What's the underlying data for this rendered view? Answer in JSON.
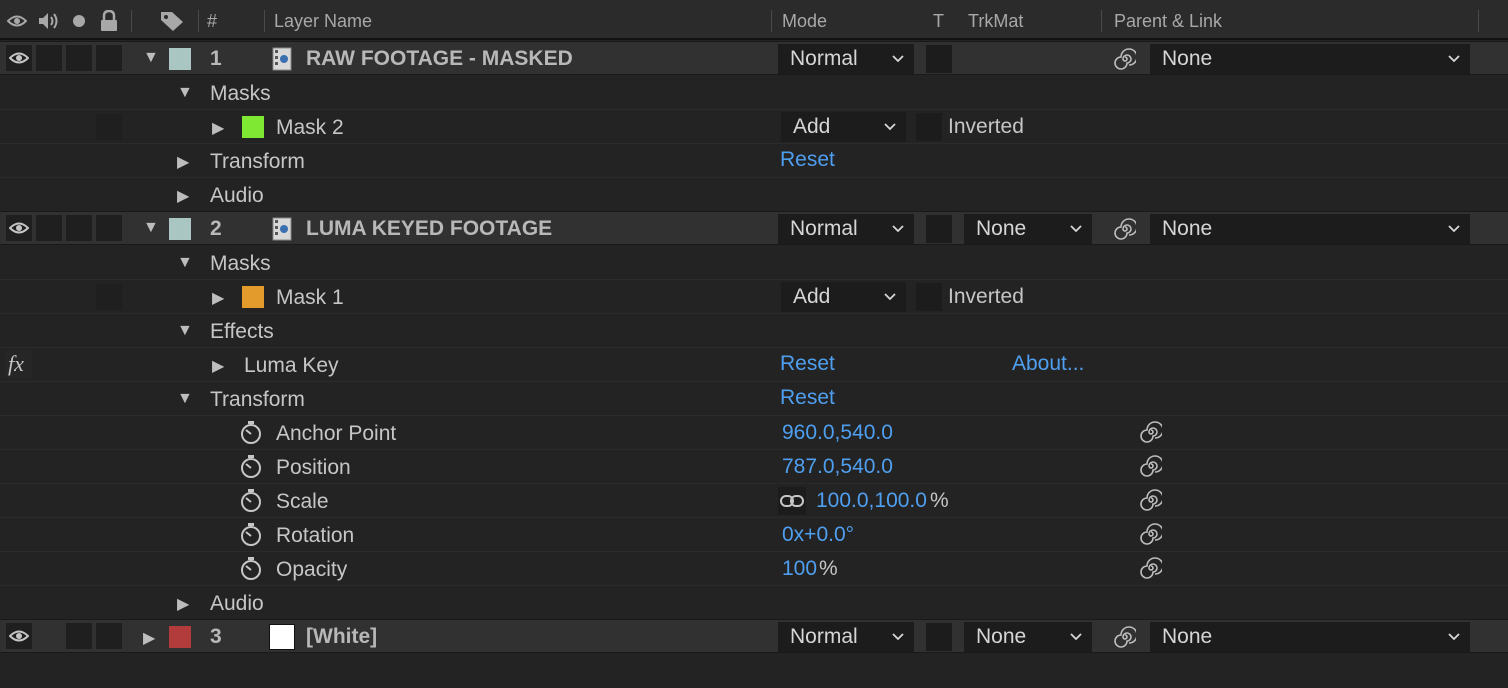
{
  "header": {
    "hash": "#",
    "layer_name": "Layer Name",
    "mode": "Mode",
    "t": "T",
    "trkmat": "TrkMat",
    "parent_link": "Parent & Link"
  },
  "colors": {
    "blue_value": "#4f9ff0",
    "label_teal": "#a9c6c2",
    "label_red": "#b23b3b",
    "mask2_green": "#7ee833",
    "mask1_orange": "#e39b2c"
  },
  "layers": [
    {
      "number": "1",
      "name": "RAW FOOTAGE - MASKED",
      "mode": "Normal",
      "parent": "None",
      "masks_label": "Masks",
      "mask": {
        "name": "Mask 2",
        "mode": "Add",
        "inverted": "Inverted"
      },
      "transform_label": "Transform",
      "transform_reset": "Reset",
      "audio_label": "Audio"
    },
    {
      "number": "2",
      "name": "LUMA KEYED FOOTAGE",
      "mode": "Normal",
      "trkmat": "None",
      "parent": "None",
      "masks_label": "Masks",
      "mask": {
        "name": "Mask 1",
        "mode": "Add",
        "inverted": "Inverted"
      },
      "effects_label": "Effects",
      "fx_label": "fx",
      "effect": {
        "name": "Luma Key",
        "reset": "Reset",
        "about": "About..."
      },
      "transform_label": "Transform",
      "transform_reset": "Reset",
      "properties": [
        {
          "name": "Anchor Point",
          "value": "960.0,540.0"
        },
        {
          "name": "Position",
          "value": "787.0,540.0"
        },
        {
          "name": "Scale",
          "value": "100.0,100.0",
          "suffix": "%"
        },
        {
          "name": "Rotation",
          "value": "0x+0.0°"
        },
        {
          "name": "Opacity",
          "value": "100",
          "suffix": "%"
        }
      ],
      "audio_label": "Audio"
    },
    {
      "number": "3",
      "name": "[White]",
      "mode": "Normal",
      "trkmat": "None",
      "parent": "None"
    }
  ]
}
